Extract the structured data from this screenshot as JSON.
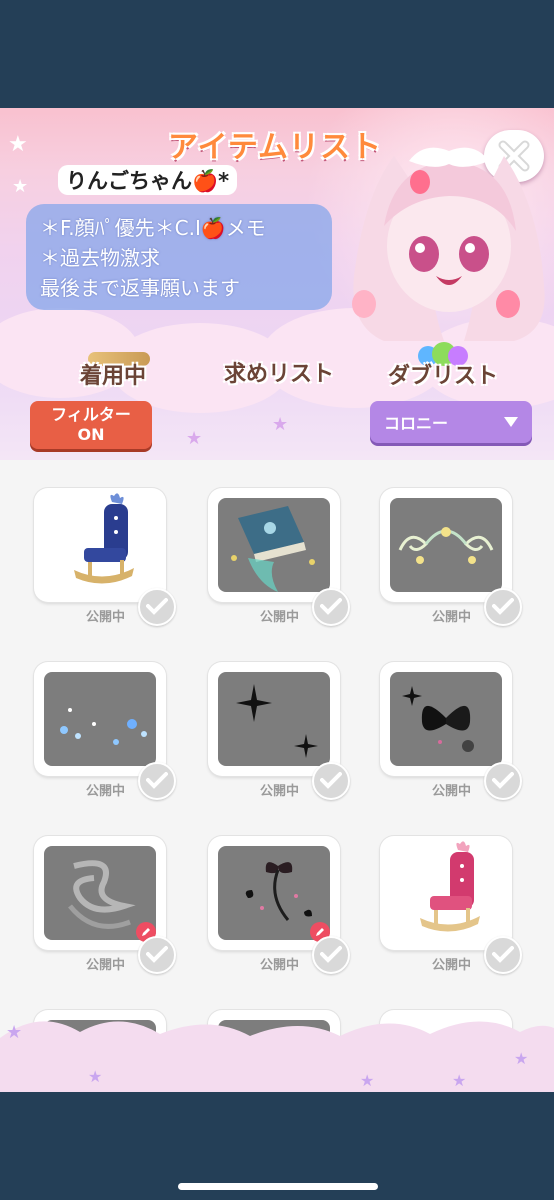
{
  "title": "アイテムリスト",
  "profile": {
    "username": "りんごちゃん🍎*",
    "bio_lines": [
      "＊F.顔ﾊﾟ優先＊C.I🍎メモ",
      "＊過去物激求",
      "最後まで返事願います"
    ]
  },
  "tabs": [
    {
      "label": "着用中"
    },
    {
      "label": "求めリスト"
    },
    {
      "label": "ダブリスト"
    }
  ],
  "filter": {
    "line1": "フィルター",
    "line2": "ON"
  },
  "colony_select": {
    "value": "コロニー"
  },
  "items": [
    {
      "status": "公開中",
      "icon": "navy-throne-chair",
      "bg": "white",
      "pen": false
    },
    {
      "status": "公開中",
      "icon": "blue-spellbook",
      "bg": "gray",
      "pen": false
    },
    {
      "status": "公開中",
      "icon": "swirl-ornament",
      "bg": "gray",
      "pen": false
    },
    {
      "status": "公開中",
      "icon": "blue-sparkle-effect",
      "bg": "gray",
      "pen": false
    },
    {
      "status": "公開中",
      "icon": "twinkle-stars",
      "bg": "gray",
      "pen": false
    },
    {
      "status": "公開中",
      "icon": "black-butterfly",
      "bg": "gray",
      "pen": false
    },
    {
      "status": "公開中",
      "icon": "smoke-swirl",
      "bg": "gray",
      "pen": true
    },
    {
      "status": "公開中",
      "icon": "black-ribbon-butterflies",
      "bg": "gray",
      "pen": true
    },
    {
      "status": "公開中",
      "icon": "pink-throne-chair",
      "bg": "white",
      "pen": false
    }
  ],
  "colors": {
    "status_bar": "#243f57",
    "title_orange": "#ff8a3c",
    "filter_red": "#e85f45",
    "select_purple": "#b487e6",
    "bio_blue": "#8aa8eb",
    "check_gray": "#d9d9d9",
    "pen_red": "#ee4d62"
  }
}
